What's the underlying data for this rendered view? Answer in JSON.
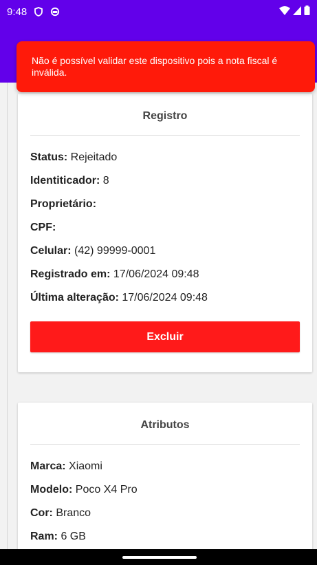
{
  "status_bar": {
    "time": "9:48",
    "icons": [
      "vpn-shield-icon",
      "sync-icon",
      "wifi-icon",
      "signal-icon",
      "battery-icon"
    ]
  },
  "toast": {
    "message": "Não é possível validar este dispositivo pois a nota fiscal é inválida."
  },
  "registro": {
    "title": "Registro",
    "fields": [
      {
        "label": "Status:",
        "value": " Rejeitado"
      },
      {
        "label": "Identiticador:",
        "value": " 8"
      },
      {
        "label": "Proprietário:",
        "value": ""
      },
      {
        "label": "CPF:",
        "value": ""
      },
      {
        "label": "Celular:",
        "value": " (42) 99999-0001"
      },
      {
        "label": "Registrado em:",
        "value": " 17/06/2024 09:48"
      },
      {
        "label": "Última alteração:",
        "value": " 17/06/2024 09:48"
      }
    ],
    "delete_label": "Excluir"
  },
  "atributos": {
    "title": "Atributos",
    "fields": [
      {
        "label": "Marca:",
        "value": " Xiaomi"
      },
      {
        "label": "Modelo:",
        "value": " Poco X4 Pro"
      },
      {
        "label": "Cor:",
        "value": " Branco"
      },
      {
        "label": "Ram:",
        "value": " 6 GB"
      }
    ]
  },
  "colors": {
    "primary": "#6200ea",
    "danger": "#ff1a1a"
  }
}
